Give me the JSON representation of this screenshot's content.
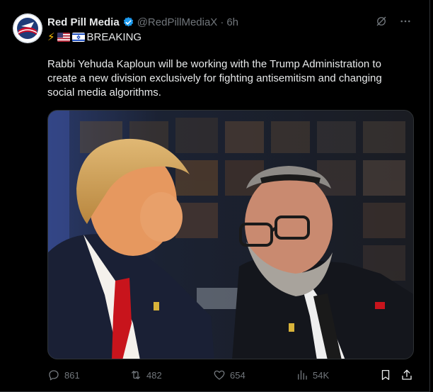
{
  "tweet": {
    "display_name": "Red Pill Media",
    "handle": "@RedPillMediaX",
    "separator": "·",
    "time": "6h",
    "breaking_label": "BREAKING",
    "emoji_prefix": "⚡",
    "body": "Rabbi Yehuda Kaploun will be working with the Trump Administration to create a new division exclusively for fighting antisemitism and changing social media algorithms."
  },
  "actions": {
    "replies": "861",
    "reposts": "482",
    "likes": "654",
    "views": "54K"
  },
  "colors": {
    "background": "#000000",
    "text": "#e7e9ea",
    "muted": "#71767b",
    "verified": "#1d9bf0",
    "border": "#2f3336"
  },
  "icons": {
    "verified": "verified-badge-icon",
    "grok": "grok-icon",
    "more": "more-icon",
    "reply": "reply-icon",
    "repost": "repost-icon",
    "like": "like-icon",
    "views": "views-icon",
    "bookmark": "bookmark-icon",
    "share": "share-icon"
  }
}
